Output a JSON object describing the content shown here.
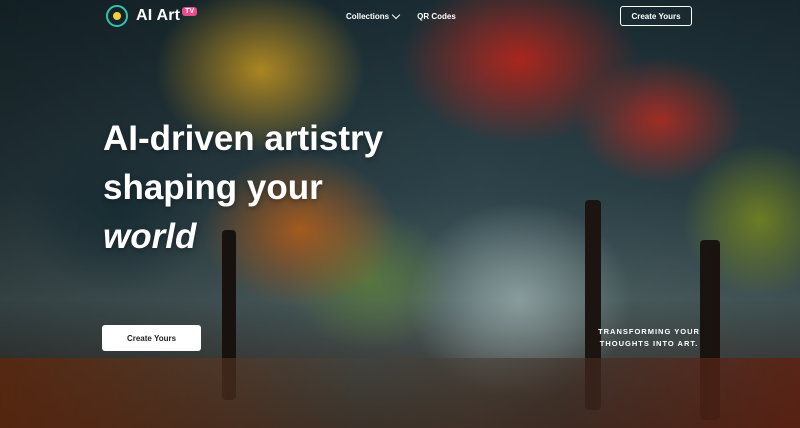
{
  "header": {
    "logo_text": "AI Art",
    "logo_badge": "TV",
    "nav": [
      {
        "label": "Collections",
        "has_dropdown": true
      },
      {
        "label": "QR Codes",
        "has_dropdown": false
      }
    ],
    "cta_label": "Create Yours"
  },
  "hero": {
    "headline_line1": "AI-driven artistry",
    "headline_line2": "shaping your",
    "headline_line3": "world",
    "cta_label": "Create Yours",
    "tagline": "TRANSFORMING YOUR THOUGHTS INTO ART."
  },
  "icons": {
    "logo": "eye-logo-icon",
    "dropdown": "chevron-down-icon"
  },
  "colors": {
    "text": "#ffffff",
    "logo_ring": "#34c3b0",
    "logo_pupil": "#f2d13a",
    "logo_badge": "#e94d8a"
  }
}
